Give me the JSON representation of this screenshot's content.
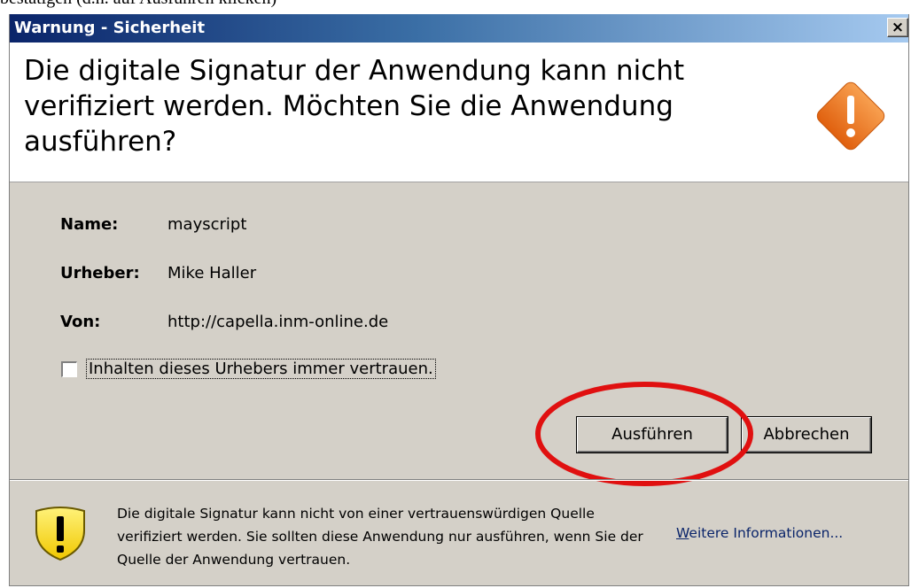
{
  "document": {
    "top_text": "bestätigen (d.h. auf Ausführen klicken)"
  },
  "window": {
    "title": "Warnung - Sicherheit",
    "close_label": "×"
  },
  "header": {
    "message": "Die digitale Signatur der Anwendung kann nicht verifiziert werden.  Möchten Sie die Anwendung ausführen?",
    "icon": "warning-diamond-icon",
    "icon_color": "#f07820"
  },
  "details": {
    "fields": [
      {
        "label": "Name:",
        "value": "mayscript"
      },
      {
        "label": "Urheber:",
        "value": "Mike Haller"
      },
      {
        "label": "Von:",
        "value": "http://capella.inm-online.de"
      }
    ]
  },
  "trust_checkbox": {
    "label": "Inhalten dieses Urhebers immer vertrauen.",
    "checked": false
  },
  "buttons": {
    "run": "Ausführen",
    "cancel": "Abbrechen"
  },
  "annotation": {
    "color": "#e01010"
  },
  "footer": {
    "icon": "warning-shield-icon",
    "message": "Die digitale Signatur kann nicht von einer vertrauenswürdigen Quelle verifiziert werden. Sie sollten diese Anwendung nur ausführen, wenn Sie der Quelle der Anwendung vertrauen.",
    "link_first_letter": "W",
    "link_rest": "eitere Informationen..."
  },
  "colors": {
    "dialog_bg": "#d4d0c8",
    "titlebar_start": "#0a246a",
    "titlebar_end": "#a6caf0"
  }
}
